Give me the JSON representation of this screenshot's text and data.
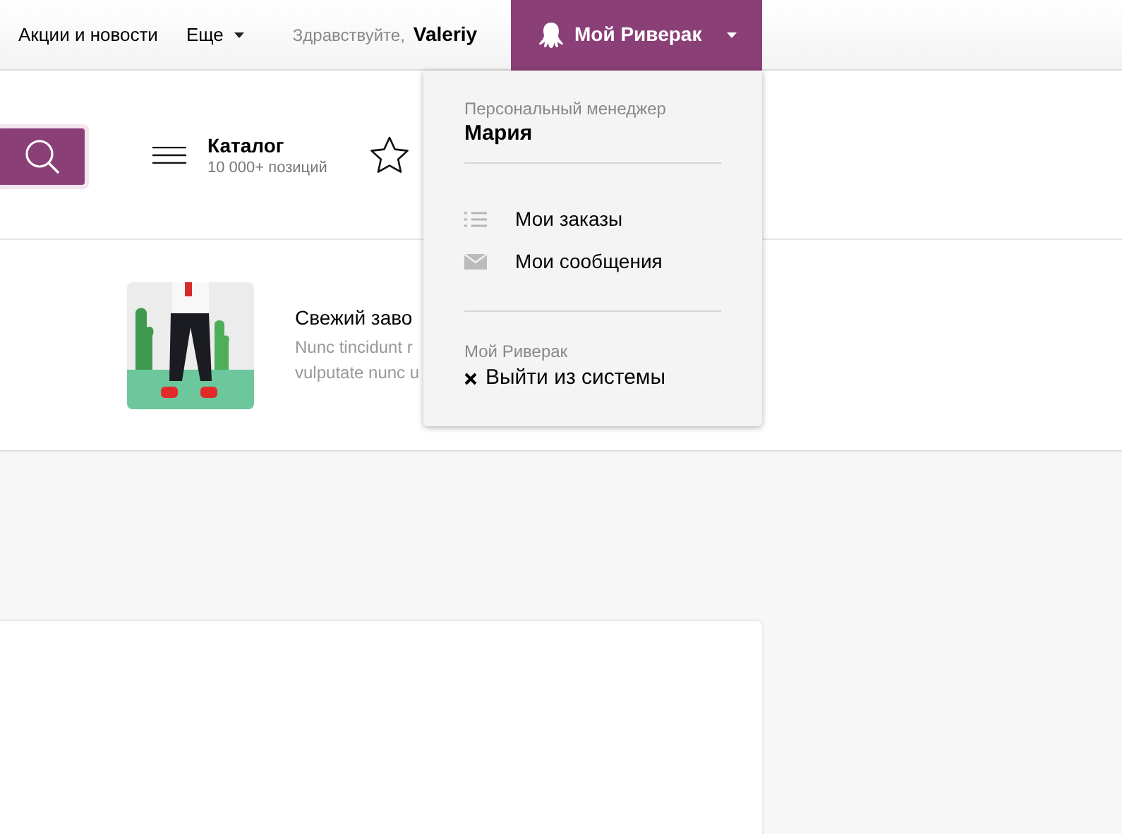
{
  "top_bar": {
    "links": [
      {
        "label": "Акции и новости",
        "kind": "link"
      },
      {
        "label": "Еще",
        "kind": "dropdown"
      }
    ],
    "greeting": "Здравствуйте,",
    "user_name": "Valeriy",
    "account_button": {
      "label": "Мой Риверак",
      "expanded": true
    }
  },
  "header": {
    "catalog": {
      "title": "Каталог",
      "subtitle": "10 000+ позиций"
    }
  },
  "promo": {
    "title": "Свежий заво",
    "text_lines": [
      "Nunc tincidunt r",
      "vulputate nunc u"
    ]
  },
  "account_menu": {
    "manager_label": "Персональный менеджер",
    "manager_name": "Мария",
    "items": [
      {
        "label": "Мои заказы",
        "kind": "orders"
      },
      {
        "label": "Мои сообщения",
        "kind": "messages"
      }
    ],
    "section_label": "Мой Риверак",
    "logout": "Выйти из системы"
  }
}
